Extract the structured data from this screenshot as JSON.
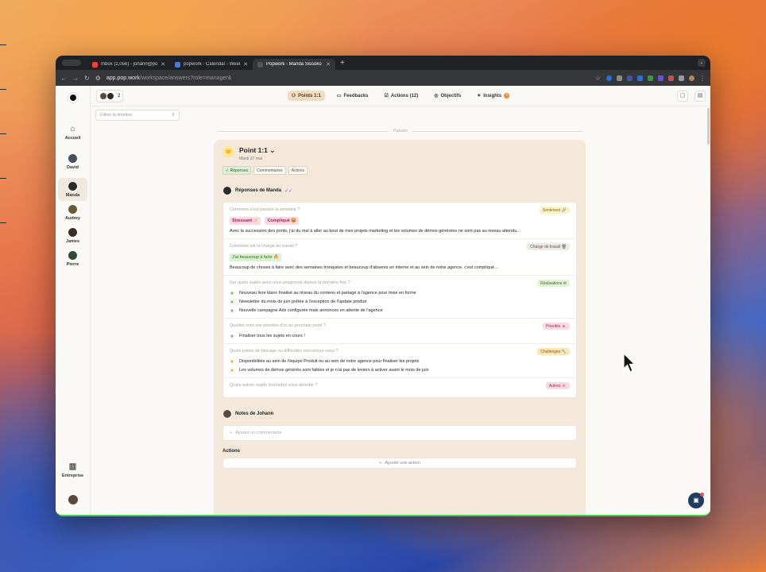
{
  "browser": {
    "tabs": [
      {
        "title": "Inbox (2,056) - johann@pop...",
        "favicon_color": "#ea4335"
      },
      {
        "title": "popwork - Calendar - Week...",
        "favicon_color": "#4a7bd8"
      },
      {
        "title": "Popwork - Manda Sissoko",
        "favicon_color": "#333333",
        "active": true
      }
    ],
    "new_tab": "+",
    "url_main": "app.pop.work",
    "url_rest": "/workspace/answers?role=manager&"
  },
  "sidebar": {
    "items": [
      {
        "label": "Accueil",
        "icon": "home-icon"
      },
      {
        "label": "David",
        "avatar_color": "#4a4f5a"
      },
      {
        "label": "Manda",
        "avatar_color": "#2b2b2b",
        "active": true
      },
      {
        "label": "Audrey",
        "avatar_color": "#6b5a3a"
      },
      {
        "label": "James",
        "avatar_color": "#3a2e2a"
      },
      {
        "label": "Pierre",
        "avatar_color": "#2f4a36"
      }
    ],
    "bottom": {
      "label": "Entreprise",
      "icon": "building-icon"
    }
  },
  "topbar": {
    "people_count": "2",
    "tabs": [
      {
        "label": "Points 1:1",
        "icon": "users-icon",
        "active": true
      },
      {
        "label": "Feedbacks",
        "icon": "message-icon"
      },
      {
        "label": "Actions (12)",
        "icon": "check-square-icon"
      },
      {
        "label": "Objectifs",
        "icon": "target-icon"
      },
      {
        "label": "Insights",
        "icon": "sparkle-icon",
        "badge": "•"
      }
    ]
  },
  "filter": {
    "placeholder": "Filtrer la timeline"
  },
  "timeline_label": "Passés",
  "point": {
    "title": "Point 1:1",
    "date": "Mardi 27 mai",
    "filters": [
      "✓ Réponses",
      "Commentaires",
      "Actions"
    ],
    "responses_title": "Réponses de Manda",
    "questions": [
      {
        "question": "Comment s'est passée la semaine ?",
        "tag": "Sentiment 🔗",
        "tag_bg": "#fbf1c4",
        "tag_color": "#8a6a10",
        "moods": [
          {
            "label": "Stressant ⚡",
            "bg": "#fbd9e4",
            "color": "#a1234f"
          },
          {
            "label": "Compliqué 😡",
            "bg": "#fbd9e4",
            "color": "#a1234f"
          }
        ],
        "answer": "Avec la succession des ponts, j'ai du mal à aller au bout de mes projets marketing et les volumes de démos générées ne sont pas au niveau attendu..."
      },
      {
        "question": "Comment est la charge de travail ?",
        "tag": "Charge de travail 🗑",
        "tag_bg": "#ece8e3",
        "tag_color": "#555",
        "moods": [
          {
            "label": "J'ai beaucoup à faire 🔥",
            "bg": "#dcf0d2",
            "color": "#2e6b22"
          }
        ],
        "answer": "Beaucoup de choses à faire avec des semaines tronquées et beaucoup d'absents en interne et au sein de notre agence, c'est compliqué..."
      },
      {
        "question": "Sur quels sujets avez-vous progressé depuis la dernière fois ?",
        "tag": "Réalisations ✉",
        "tag_bg": "#e3f2d6",
        "tag_color": "#3b6b22",
        "dot_color": "#2e9d3a",
        "dot_bg": "#dff1dd",
        "items": [
          "Nouveau livre blanc finalisé au niveau du contenu et partagé à l'agence pour mise en forme",
          "Newsletter du mois de juin prêtée à l'exception de l'update produit",
          "Nouvelle campagne Ads configurée mais annonces en attente de l'agence"
        ]
      },
      {
        "question": "Quelles sont vos priorités d'ici au prochain point ?",
        "tag": "Priorités 🔺",
        "tag_bg": "#f9dbe4",
        "tag_color": "#a1234f",
        "dot_color": "#9a57c9",
        "dot_bg": "#efe1f7",
        "items": [
          "Finaliser tous les sujets en cours !"
        ]
      },
      {
        "question": "Quels points de blocage ou difficultés rencontrez-vous ?",
        "tag": "Challenges 🔧",
        "tag_bg": "#fbe6b5",
        "tag_color": "#8a5a10",
        "dot_color": "#c98a1a",
        "dot_bg": "#fbecc6",
        "items": [
          "Disponibilités au sein de l'équipe Produit ou au sein de notre agence pour finaliser les projets",
          "Les volumes de démos générés sont faibles et je n'ai pas de leviers à activer avant le mois de juin"
        ]
      },
      {
        "question": "Quels autres sujets souhaitez-vous aborder ?",
        "tag": "Autres 🌸",
        "tag_bg": "#f9dbe4",
        "tag_color": "#a1234f"
      }
    ],
    "notes_title": "Notes de Johann",
    "comment_placeholder": "Ajouter un commentaire",
    "actions_title": "Actions",
    "add_action": "Ajouter une action"
  }
}
